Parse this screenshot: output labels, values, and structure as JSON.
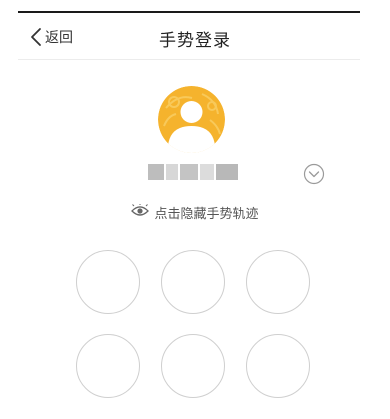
{
  "header": {
    "back_label": "返回",
    "title": "手势登录"
  },
  "icons": {
    "back": "chevron-left-icon",
    "avatar": "user-avatar-icon",
    "switch_account": "chevron-down-circle-icon",
    "eye": "eye-icon"
  },
  "colors": {
    "avatar_background": "#f5b32d",
    "avatar_figure": "#ffffff",
    "dot_border": "#cfcfcf",
    "divider": "#ececec"
  },
  "gesture": {
    "hide_trail_label": "点击隐藏手势轨迹",
    "visible_dot_count": 6
  }
}
